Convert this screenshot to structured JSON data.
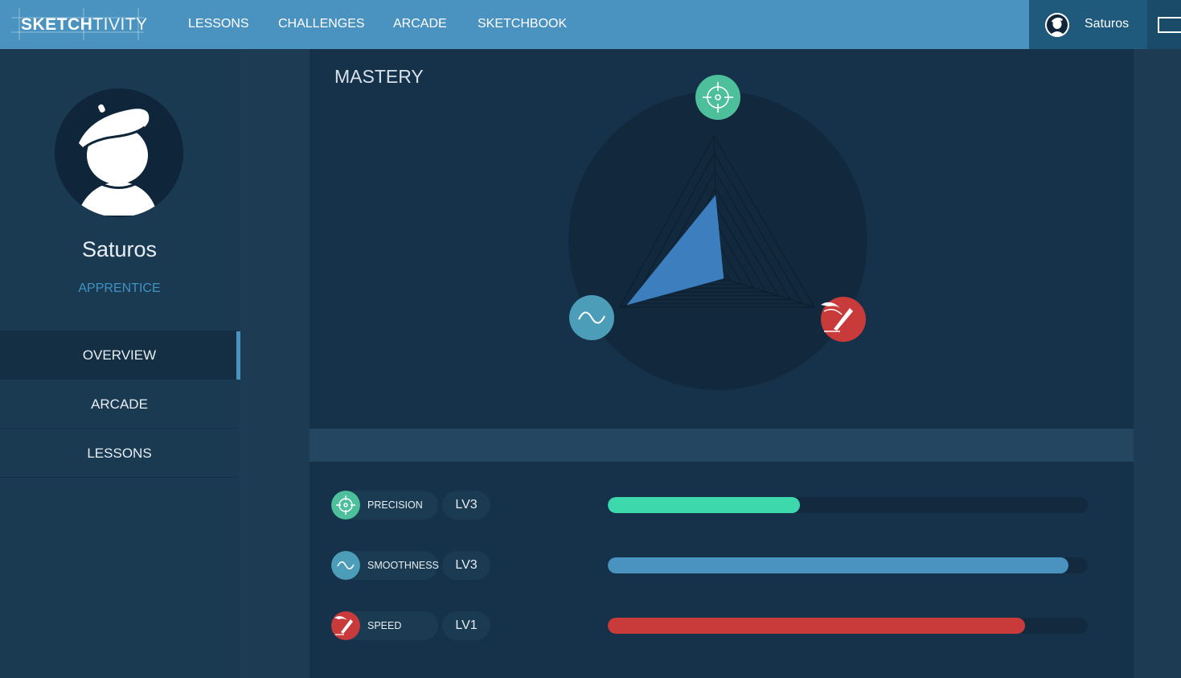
{
  "app": {
    "logo_bold": "SKETCH",
    "logo_thin": "TIVITY"
  },
  "nav": {
    "items": [
      {
        "label": "LESSONS"
      },
      {
        "label": "CHALLENGES"
      },
      {
        "label": "ARCADE"
      },
      {
        "label": "SKETCHBOOK"
      }
    ],
    "user_name": "Saturos"
  },
  "sidebar": {
    "name": "Saturos",
    "rank": "APPRENTICE",
    "items": [
      {
        "label": "OVERVIEW",
        "active": true
      },
      {
        "label": "ARCADE",
        "active": false
      },
      {
        "label": "LESSONS",
        "active": false
      }
    ]
  },
  "mastery": {
    "title": "MASTERY",
    "axes": [
      "precision",
      "speed",
      "smoothness"
    ],
    "levels": {
      "precision": 0.58,
      "speed": 0.0,
      "smoothness": 0.93
    }
  },
  "stats": [
    {
      "key": "precision",
      "label": "PRECISION",
      "level": "LV3",
      "progress": 0.4,
      "color": "#3ed8ad",
      "icon": "crosshair-icon",
      "icon_bg": "#4dbf9b"
    },
    {
      "key": "smoothness",
      "label": "SMOOTHNESS",
      "level": "LV3",
      "progress": 0.96,
      "color": "#4a92c0",
      "icon": "wave-icon",
      "icon_bg": "#4b9db8"
    },
    {
      "key": "speed",
      "label": "SPEED",
      "level": "LV1",
      "progress": 0.87,
      "color": "#c93a3a",
      "icon": "winged-pencil-icon",
      "icon_bg": "#c93a3a"
    }
  ],
  "colors": {
    "accent": "#4a92c0",
    "precision": "#4dbf9b",
    "smoothness": "#4b9db8",
    "speed": "#c93a3a"
  }
}
